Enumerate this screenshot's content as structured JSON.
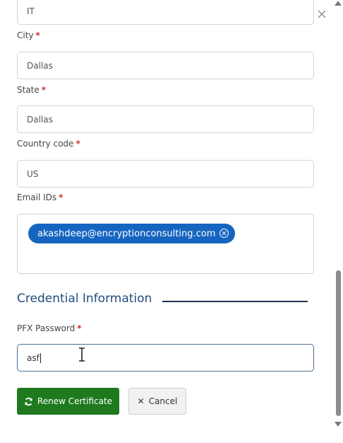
{
  "form": {
    "org_unit_value": "IT",
    "city": {
      "label": "City",
      "value": "Dallas"
    },
    "state": {
      "label": "State",
      "value": "Dallas"
    },
    "country": {
      "label": "Country code",
      "value": "US"
    },
    "email": {
      "label": "Email IDs",
      "chips": [
        "akashdeep@encryptionconsulting.com"
      ]
    },
    "required_mark": "*"
  },
  "credential": {
    "section_title": "Credential Information",
    "pfx_label": "PFX Password",
    "pfx_value": "asf"
  },
  "actions": {
    "renew_label": "Renew Certificate",
    "cancel_label": "Cancel"
  },
  "colors": {
    "renew_button": "#1f7a1f",
    "chip": "#1565c0",
    "required": "#d32f2f"
  },
  "icons": {
    "close": "close-icon",
    "chip_remove": "circle-x-icon",
    "renew": "refresh-icon",
    "cancel": "x-icon",
    "cursor": "ibeam-cursor-icon"
  }
}
